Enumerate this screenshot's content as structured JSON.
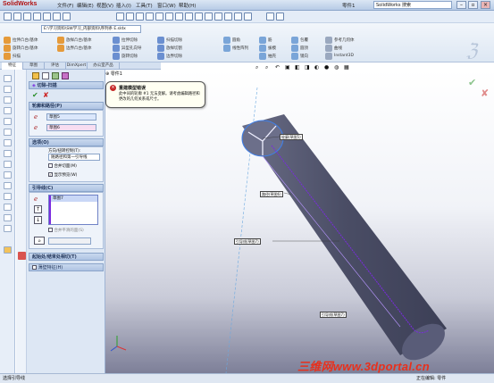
{
  "app": {
    "logo_text": "SolidWorks",
    "menus": [
      "文件(F)",
      "编辑(E)",
      "视图(V)",
      "插入(I)",
      "工具(T)",
      "窗口(W)",
      "帮助(H)"
    ],
    "doc_title": "零件1",
    "search_placeholder": "SolidWorks 搜索",
    "window_controls": [
      "minimize-icon",
      "restore-icon",
      "close-icon"
    ]
  },
  "toolbar": {
    "path_value": "E:\\学习资料\\SW学习_内部资料\\序列条 E.sldx"
  },
  "command_manager": {
    "items": [
      "拉伸凸台/基体",
      "旋转凸台/基体",
      "扫描",
      "放样凸台/基体",
      "边界凸台/基体",
      "拉伸切除",
      "异型孔向导",
      "旋转切除",
      "扫描切除",
      "放样切割",
      "边界切除",
      "圆角",
      "线性阵列",
      "筋",
      "拔模",
      "抽壳",
      "包覆",
      "圆顶",
      "镜向",
      "参考几何体",
      "曲线",
      "Instant3D"
    ]
  },
  "tabs": [
    "特征",
    "草图",
    "评估",
    "DimXpert",
    "办公室产品"
  ],
  "feature_tree_label": "零件1",
  "property_manager": {
    "title": "切除-扫描",
    "section_profile": "轮廓和路径(P)",
    "profile_field": "草图5",
    "path_field": "草图6",
    "section_options": "选项(O)",
    "orientation_label": "方向/扭转控制(T):",
    "orientation_value": "随路径和第一引导线",
    "merge_tangent": "合并切面(M)",
    "show_preview": "显示预览(W)",
    "section_guides": "引导线(C)",
    "guide_item": "草图7",
    "merge_smooth": "合并平滑的面(S)",
    "section_start_end": "起始处/结束处相切(T)",
    "section_thin": "薄壁特征(H)"
  },
  "tooltip": {
    "title": "重建模型错误",
    "body": "此中间的轮廓 #1 无法变解。请考虑编辑路径和更改的几何关系或尺寸。"
  },
  "callouts": [
    "轮廓(草图5)",
    "路径(草图6)",
    "引导线(草图7)",
    "引导线(草图7)"
  ],
  "status": {
    "left": "选择引导线",
    "right": "正在编辑: 零件"
  },
  "watermark": "三维网www.3dportal.cn",
  "colors": {
    "path_purple": "#7b2be0",
    "tube_dark": "#4c4f67",
    "accent_red": "#e8301c"
  }
}
